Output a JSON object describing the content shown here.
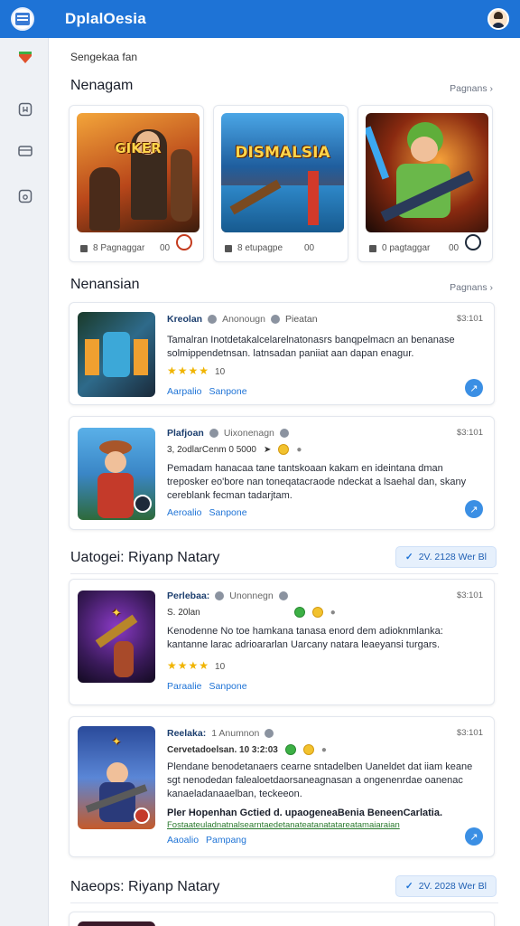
{
  "app": {
    "title": "DplalOesia"
  },
  "breadcrumb": "Sengekaa fan",
  "sections": {
    "featured": {
      "title": "Nenagam",
      "see_all": "Pagnans"
    },
    "recent": {
      "title": "Nenansian",
      "see_all": "Pagnans"
    },
    "upcoming_1": {
      "title": "Uatogei: Riyanp Natary",
      "filter": "2V. 2128 Wer Bl"
    },
    "upcoming_2": {
      "title": "Naeops: Riyanp Natary",
      "filter": "2V. 2028 Wer Bl"
    }
  },
  "tiles": [
    {
      "art_label": "GIKER",
      "meta": "8 Pagnaggar",
      "count": "00"
    },
    {
      "art_label": "DISMALSIA",
      "meta": "8 etupagpe",
      "count": "00"
    },
    {
      "art_label": "",
      "meta": "0 pagtaggar",
      "count": "00"
    }
  ],
  "cards": [
    {
      "name": "Kreolan",
      "sub": "Anonougn",
      "tag": "Pieatan",
      "time": "$3:101",
      "body": "Tamalran Inotdetakalcelarelnatonasrs banqpelmacn an benanase solmippendetnsan. latnsadan paniiat aan dapan enagur.",
      "stars": "★★★★",
      "rating": "10",
      "action_1": "Aarpalio",
      "action_2": "Sanpone"
    },
    {
      "name": "Plafjoan",
      "sub": "Uixonenagn",
      "tag": "",
      "time": "$3:101",
      "line2": "3, 2odlarCenm 0 5000",
      "body": "Pemadam hanacaa tane tantskoaan kakam en ideintana dman treposker eo'bore nan toneqatacraode ndeckat a lsaehal dan, skany cereblank fecman tadarjtam.",
      "action_1": "Aeroalio",
      "action_2": "Sanpone"
    },
    {
      "name": "Perlebaa:",
      "sub": "Unonnegn",
      "tag": "",
      "time": "$3:101",
      "line2": "S. 20lan",
      "body": "Kenodenne No toe hamkana tanasa enord dem adioknmlanka: kantanne larac adrioararlan Uarcany natara leaeyansi turgars.",
      "stars": "★★★★",
      "rating": "10",
      "action_1": "Paraalie",
      "action_2": "Sanpone"
    },
    {
      "name": "Reelaka:",
      "sub": "1 Anumnon",
      "tag": "",
      "time": "$3:101",
      "line2": "Cervetadoelsan. 10 3:2:03",
      "body": "Plendane benodetanaers cearne sntadelben Uaneldet dat iiam keane sgt nenodedan falealoetdaorsaneagnasan a ongenenrdae oanenac kanaeladanaaelban, teckeeon.",
      "bold": "Pler Hopenhan Gctied d. upaogeneaBenia BeneenCarlatia.",
      "green": "Fostaateuladnatnalsearntaedetanateatanatatareatamaiaraian",
      "action_1": "Aaoalio",
      "action_2": "Pampang"
    }
  ],
  "colors": {
    "accent": "#1e73d6",
    "star": "#f0b400"
  }
}
